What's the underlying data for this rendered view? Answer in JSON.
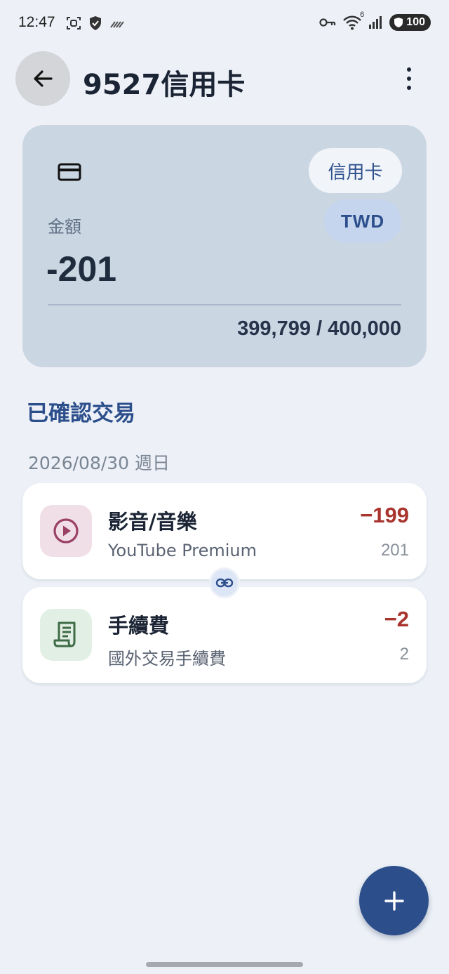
{
  "status_bar": {
    "time": "12:47",
    "wifi_badge": "6",
    "battery": "100",
    "icons_left": [
      "screenshot-icon",
      "shield-icon",
      "signal-off-icon"
    ],
    "icons_right": [
      "vpn-key-icon",
      "wifi-icon",
      "cell-signal-icon",
      "battery-icon"
    ]
  },
  "header": {
    "title": "9527信用卡",
    "back_icon": "arrow-back-icon",
    "more_icon": "more-vert-icon"
  },
  "account": {
    "type_chip": "信用卡",
    "currency": "TWD",
    "amount_label": "金額",
    "amount": "-201",
    "limit": "399,799 / 400,000",
    "icon": "credit-card-icon"
  },
  "section": {
    "title": "已確認交易",
    "date": "2026/08/30 週日"
  },
  "transactions": [
    {
      "category": "影音/音樂",
      "description": "YouTube Premium",
      "amount": "−199",
      "sub_value": "201",
      "icon": "play-circle-icon",
      "icon_bg": "#f1dfe7",
      "icon_color": "#9a4166"
    },
    {
      "category": "手續費",
      "description": "國外交易手續費",
      "amount": "−2",
      "sub_value": "2",
      "icon": "receipt-icon",
      "icon_bg": "#e2efe4",
      "icon_color": "#3f6b46"
    }
  ],
  "link_icon": "link-icon",
  "fab_icon": "add-icon",
  "colors": {
    "accent": "#2c4f8c",
    "negative": "#a8342d",
    "background": "#edf1f7",
    "card": "#cbd6e3"
  }
}
